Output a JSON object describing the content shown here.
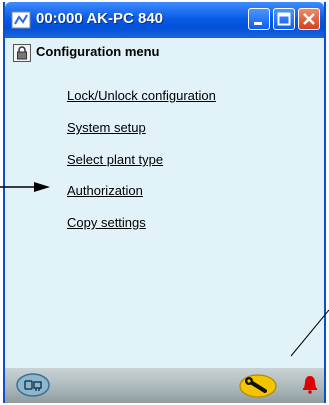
{
  "window": {
    "title": "00:000 AK-PC 840"
  },
  "menu": {
    "title": "Configuration menu",
    "items": [
      {
        "label": "Lock/Unlock configuration"
      },
      {
        "label": "System setup"
      },
      {
        "label": "Select plant type"
      },
      {
        "label": "Authorization"
      },
      {
        "label": "Copy settings"
      }
    ]
  },
  "icons": {
    "app": "network-icon",
    "lock": "lock-icon",
    "service": "service-tool-icon",
    "wrench": "wrench-icon",
    "alarm": "alarm-bell-icon"
  },
  "colors": {
    "titlebar": "#0a5ce8",
    "content_bg": "#e2f2f9",
    "alarm": "#e00000",
    "wrench_badge": "#f5c400"
  }
}
